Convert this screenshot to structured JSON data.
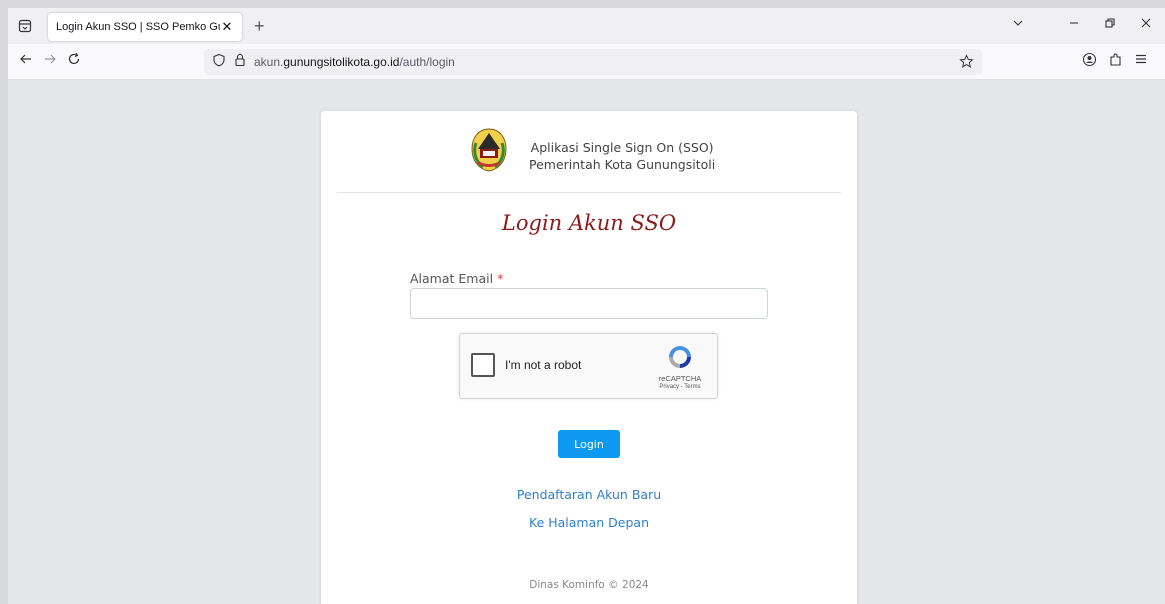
{
  "browser": {
    "tab_title": "Login Akun SSO | SSO Pemko Gunu",
    "tab_close": "✕",
    "new_tab": "+",
    "url_prefix": "akun.",
    "url_domain": "gunungsitolikota.go.id",
    "url_path": "/auth/login",
    "icons": {
      "tab_list": "list-all-tabs-icon",
      "back": "back-arrow-icon",
      "forward": "forward-arrow-icon",
      "reload": "reload-icon",
      "tracking": "shield-icon",
      "lock": "lock-icon",
      "bookmark": "star-icon",
      "account": "account-icon",
      "extensions": "extensions-icon",
      "menu": "hamburger-menu-icon"
    }
  },
  "header": {
    "title_line1": "Aplikasi Single Sign On (SSO)",
    "title_line2": "Pemerintah Kota Gunungsitoli"
  },
  "form": {
    "heading": "Login Akun SSO",
    "email_label": "Alamat Email",
    "required_mark": "*",
    "email_value": "",
    "login_label": "Login"
  },
  "recaptcha": {
    "label": "I'm not a robot",
    "brand": "reCAPTCHA",
    "links": "Privacy - Terms"
  },
  "links": {
    "register": "Pendaftaran Akun Baru",
    "home": "Ke Halaman Depan"
  },
  "footer": {
    "text": "Dinas Kominfo © 2024"
  },
  "colors": {
    "heading": "#8b1a1a",
    "button": "#0d99f2",
    "link": "#2f7fd0",
    "required": "#e53935"
  }
}
